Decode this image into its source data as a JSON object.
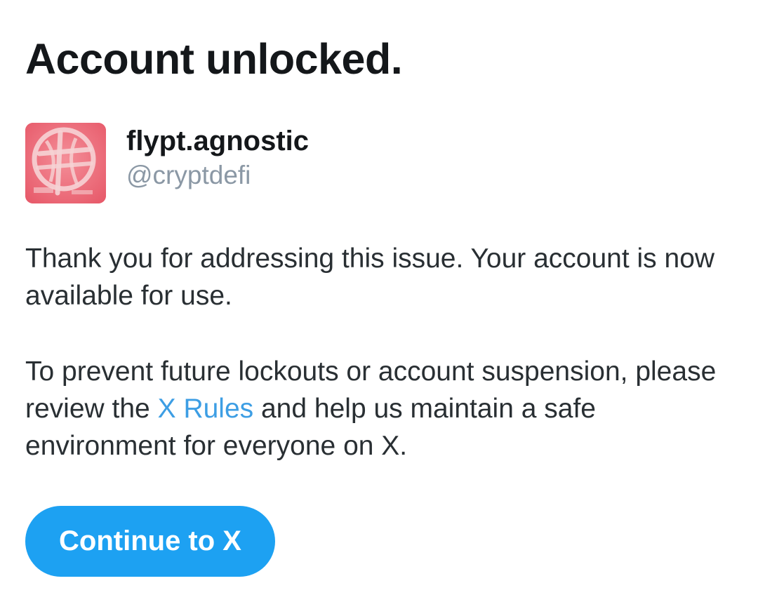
{
  "title": "Account unlocked.",
  "account": {
    "display_name": "flypt.agnostic",
    "handle": "@cryptdefi",
    "avatar_icon": "profile-avatar"
  },
  "message": {
    "p1": "Thank you for addressing this issue. Your account is now available for use.",
    "p2_before": "To prevent future lockouts or account suspension, please review the ",
    "p2_link": "X Rules",
    "p2_after": " and help us maintain a safe environment for everyone on X."
  },
  "button": {
    "label": "Continue to X"
  },
  "colors": {
    "text": "#14171a",
    "muted": "#8b98a5",
    "link": "#3d9ee4",
    "button_bg": "#1da1f2",
    "avatar_bg": "#ec6f7c"
  }
}
